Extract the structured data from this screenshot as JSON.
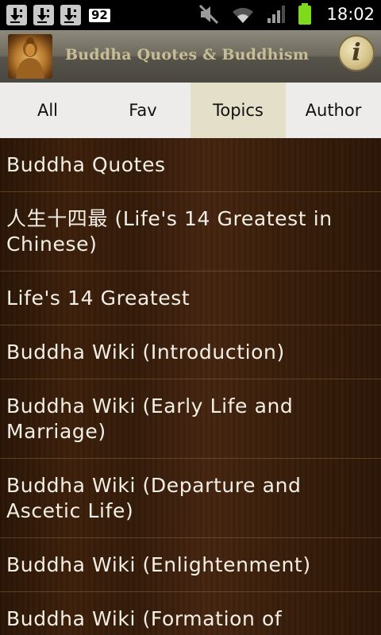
{
  "status_bar": {
    "battery_level": "92",
    "time": "18:02",
    "icons": [
      "download-icon",
      "download-icon",
      "download-icon",
      "mute-icon",
      "wifi-icon",
      "signal-icon",
      "battery-icon"
    ]
  },
  "app_bar": {
    "title": "Buddha Quotes & Buddhism",
    "logo_icon": "buddha-logo-icon",
    "info_icon": "info-icon"
  },
  "tabs": [
    {
      "label": "All",
      "selected": false
    },
    {
      "label": "Fav",
      "selected": false
    },
    {
      "label": "Topics",
      "selected": true
    },
    {
      "label": "Author",
      "selected": false
    }
  ],
  "topics": [
    {
      "label": "Buddha Quotes"
    },
    {
      "label": "人生十四最 (Life's 14 Greatest in Chinese)"
    },
    {
      "label": "Life's 14 Greatest"
    },
    {
      "label": "Buddha Wiki (Introduction)"
    },
    {
      "label": "Buddha Wiki (Early Life and Marriage)"
    },
    {
      "label": "Buddha Wiki (Departure and Ascetic Life)"
    },
    {
      "label": "Buddha Wiki (Enlightenment)"
    },
    {
      "label": "Buddha Wiki (Formation of"
    }
  ],
  "colors": {
    "selected_tab": "#e3dfc8",
    "tab_bar": "#eeecea",
    "list_text": "#f4efe6",
    "title_text": "#c9bd96"
  }
}
